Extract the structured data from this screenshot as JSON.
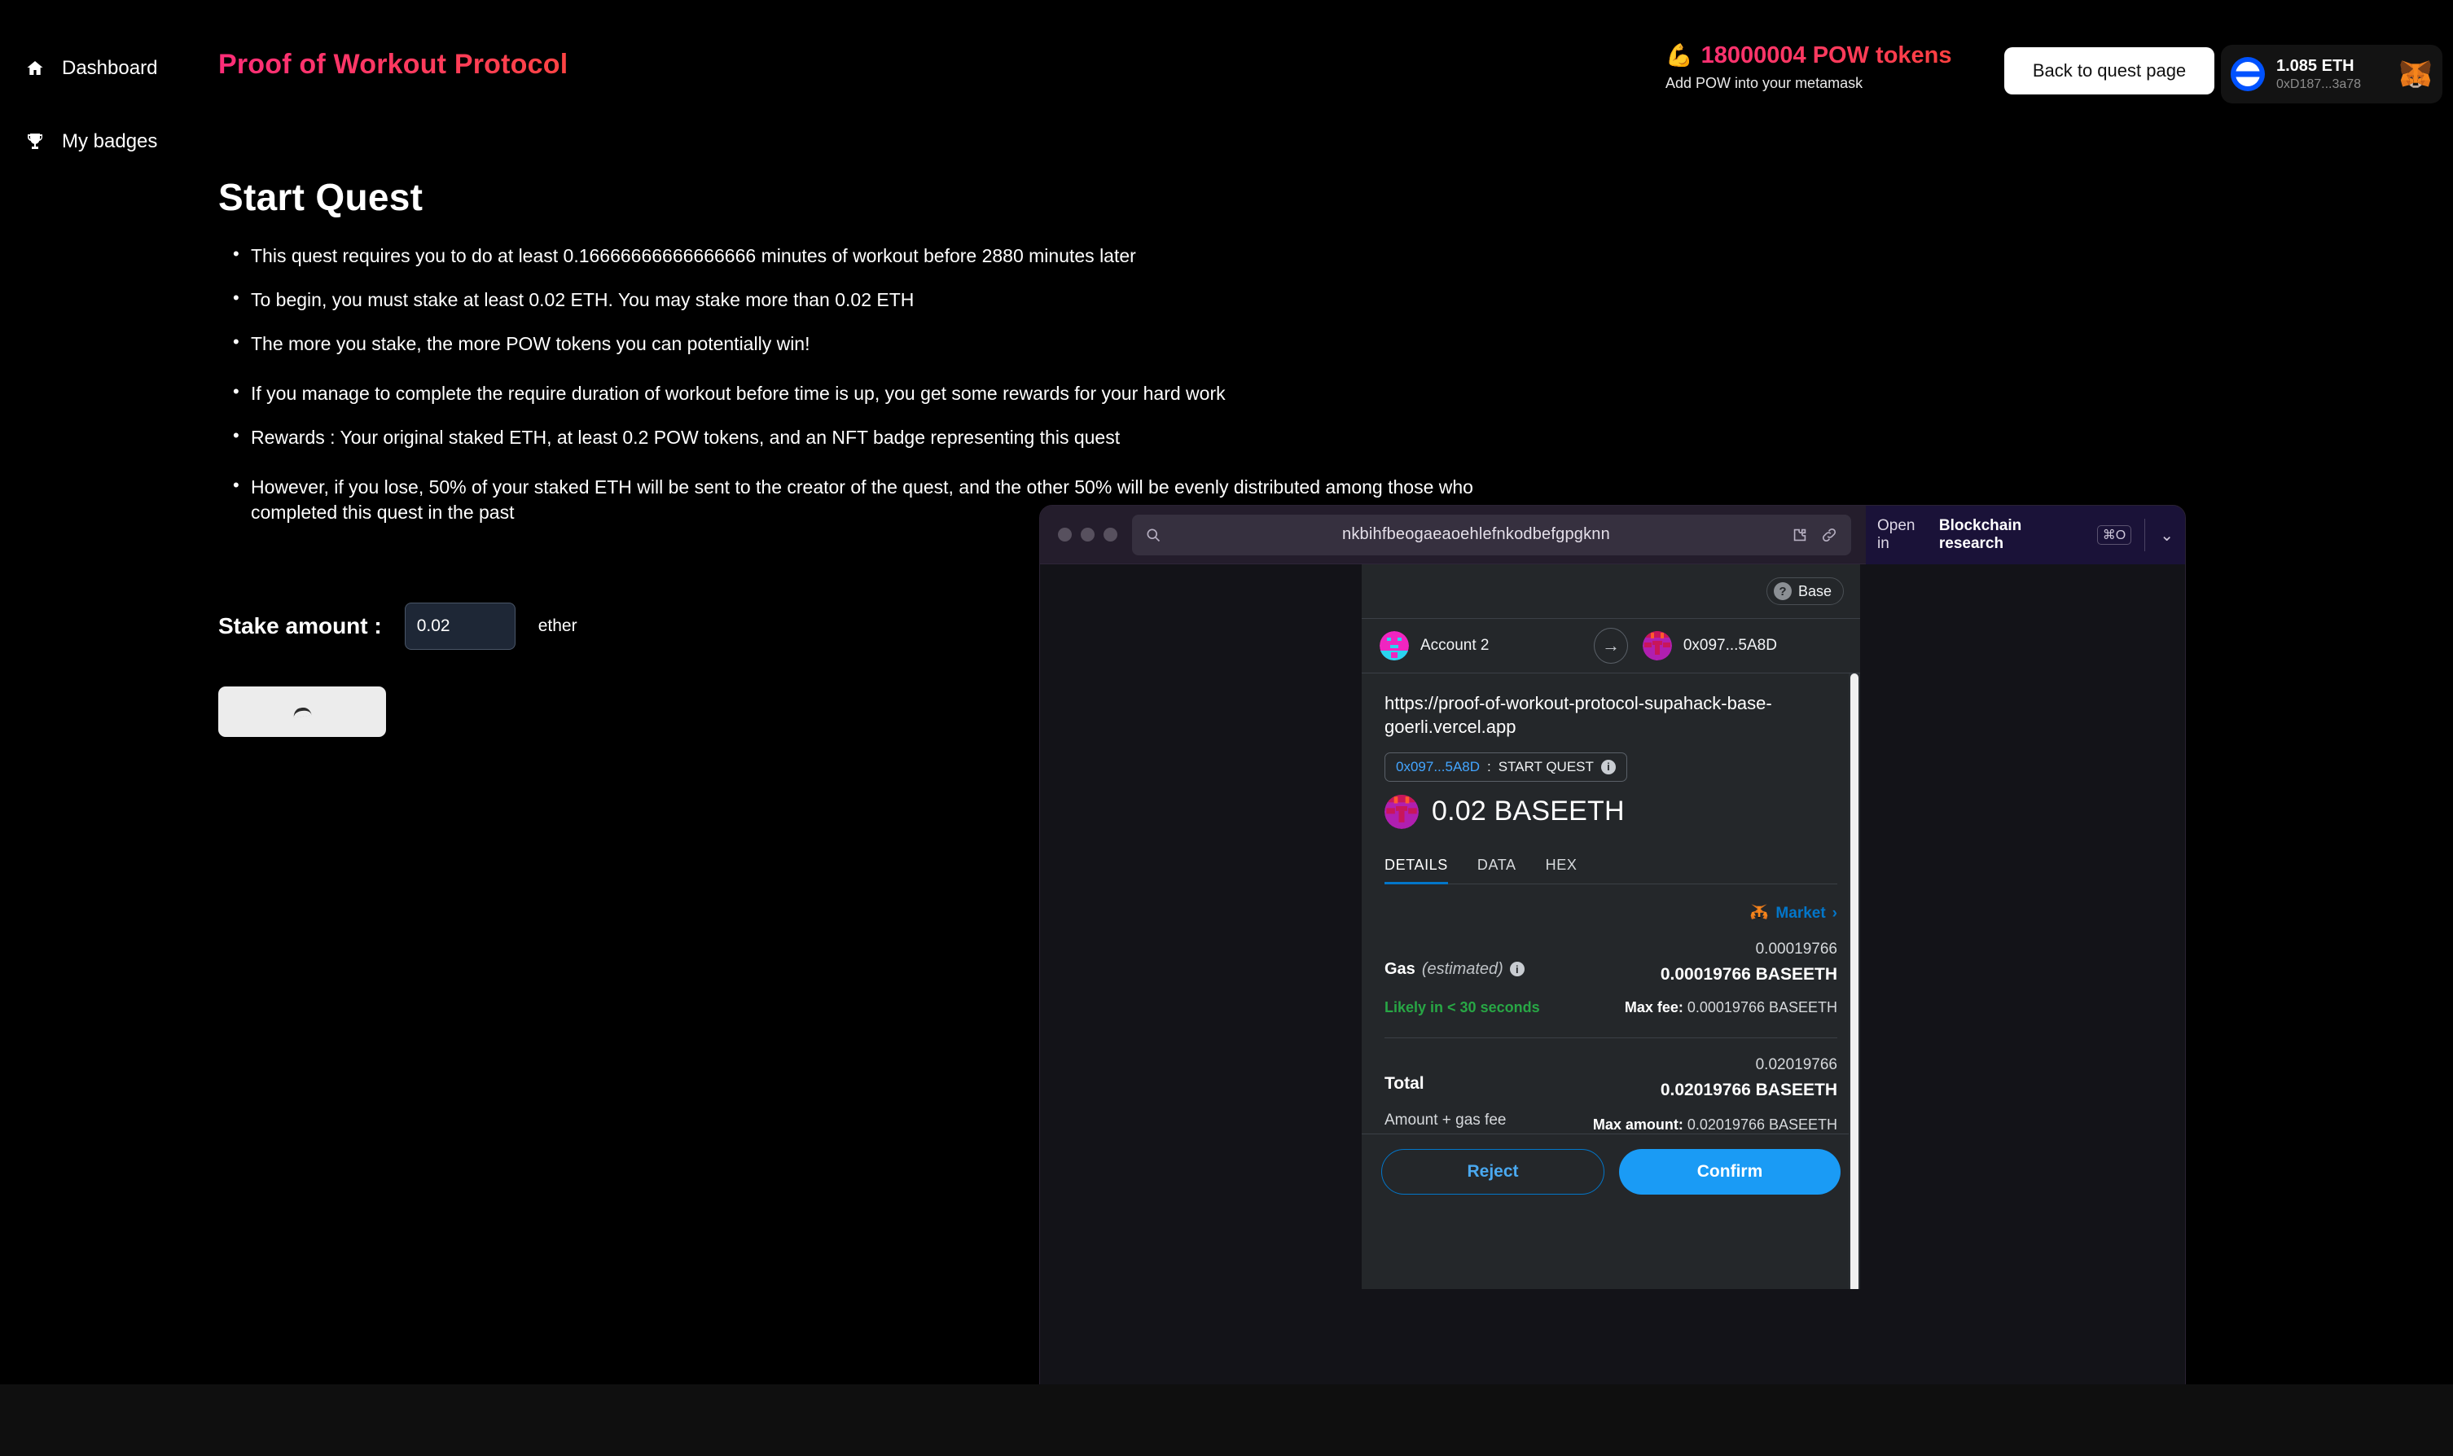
{
  "sidebar": {
    "items": [
      {
        "label": "Dashboard",
        "icon": "home-icon"
      },
      {
        "label": "My badges",
        "icon": "trophy-icon"
      }
    ]
  },
  "header": {
    "brand": "Proof of Workout Protocol",
    "brand_color": "#ff2d78",
    "pow": {
      "icon": "flexed-biceps-icon",
      "amount": "18000004 POW tokens",
      "subtitle": "Add POW into your metamask"
    },
    "back_button": "Back to quest page",
    "wallet": {
      "network_icon": "base-network-icon",
      "balance": "1.085 ETH",
      "address": "0xD187...3a78",
      "wallet_icon": "metamask-fox-icon"
    }
  },
  "main": {
    "title": "Start Quest",
    "rules": [
      "This quest requires you to do at least 0.16666666666666666 minutes of workout before 2880 minutes later",
      "To begin, you must stake at least 0.02 ETH. You may stake more than 0.02 ETH",
      "The more you stake, the more POW tokens you can potentially win!"
    ],
    "rules2": [
      "If you manage to complete the require duration of workout before time is up, you get some rewards for your hard work",
      "Rewards : Your original staked ETH, at least 0.2 POW tokens, and an NFT badge representing this quest"
    ],
    "rules3": [
      "However, if you lose, 50% of your staked ETH will be sent to the creator of the quest, and the other 50% will be evenly distributed among those who completed this quest in the past"
    ],
    "stake": {
      "label": "Stake amount :",
      "value": "0.02",
      "placeholder": "0.02",
      "unit": "ether"
    },
    "submit_button_state": "loading"
  },
  "popup": {
    "chrome": {
      "url": "nkbihfbeogaeaoehlefnkodbefgpgknn",
      "open_in_prefix": "Open in",
      "open_in_target": "Blockchain research",
      "shortcut": "⌘O"
    },
    "metamask": {
      "network": "Base",
      "from_account": "Account 2",
      "to_account": "0x097...5A8D",
      "site_url": "https://proof-of-workout-protocol-supahack-base-goerli.vercel.app",
      "method_address": "0x097...5A8D",
      "method_separator": " : ",
      "method_name": "START QUEST",
      "amount": "0.02 BASEETH",
      "tabs": [
        {
          "label": "DETAILS",
          "active": true
        },
        {
          "label": "DATA",
          "active": false
        },
        {
          "label": "HEX",
          "active": false
        }
      ],
      "market_link": "Market",
      "gas": {
        "label": "Gas",
        "estimated_note": "(estimated)",
        "native_value": "0.00019766",
        "fiat_value": "0.00019766 BASEETH",
        "speed": "Likely in < 30 seconds",
        "max_fee_label": "Max fee:",
        "max_fee_value": "0.00019766 BASEETH"
      },
      "total": {
        "label": "Total",
        "sublabel": "Amount + gas fee",
        "native_value": "0.02019766",
        "fiat_value": "0.02019766 BASEETH",
        "max_amount_label": "Max amount:",
        "max_amount_value": "0.02019766 BASEETH"
      },
      "reject_button": "Reject",
      "confirm_button": "Confirm",
      "accent_color": "#0376c9",
      "success_color": "#28a745"
    }
  }
}
